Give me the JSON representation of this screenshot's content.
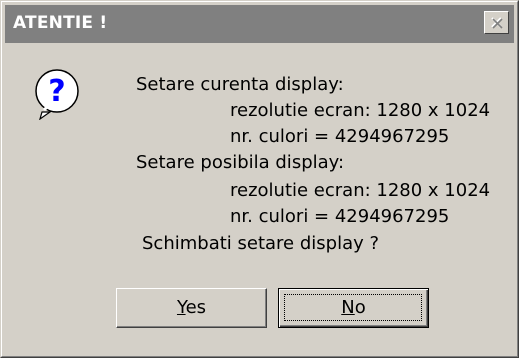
{
  "window": {
    "title": "ATENTIE !",
    "close_icon": "close-icon"
  },
  "icon": "question-icon",
  "message": {
    "line1": "Setare curenta display:",
    "line2": "rezolutie ecran: 1280 x 1024",
    "line3": "nr. culori = 4294967295",
    "line4": "Setare posibila display:",
    "line5": "rezolutie ecran: 1280 x 1024",
    "line6": "nr. culori = 4294967295",
    "line7": "Schimbati setare display ?"
  },
  "buttons": {
    "yes": {
      "accel": "Y",
      "rest": "es"
    },
    "no": {
      "accel": "N",
      "rest": "o"
    }
  },
  "colors": {
    "face": "#d4d0c8",
    "title_inactive": "#808080",
    "icon_blue": "#0000ff"
  }
}
